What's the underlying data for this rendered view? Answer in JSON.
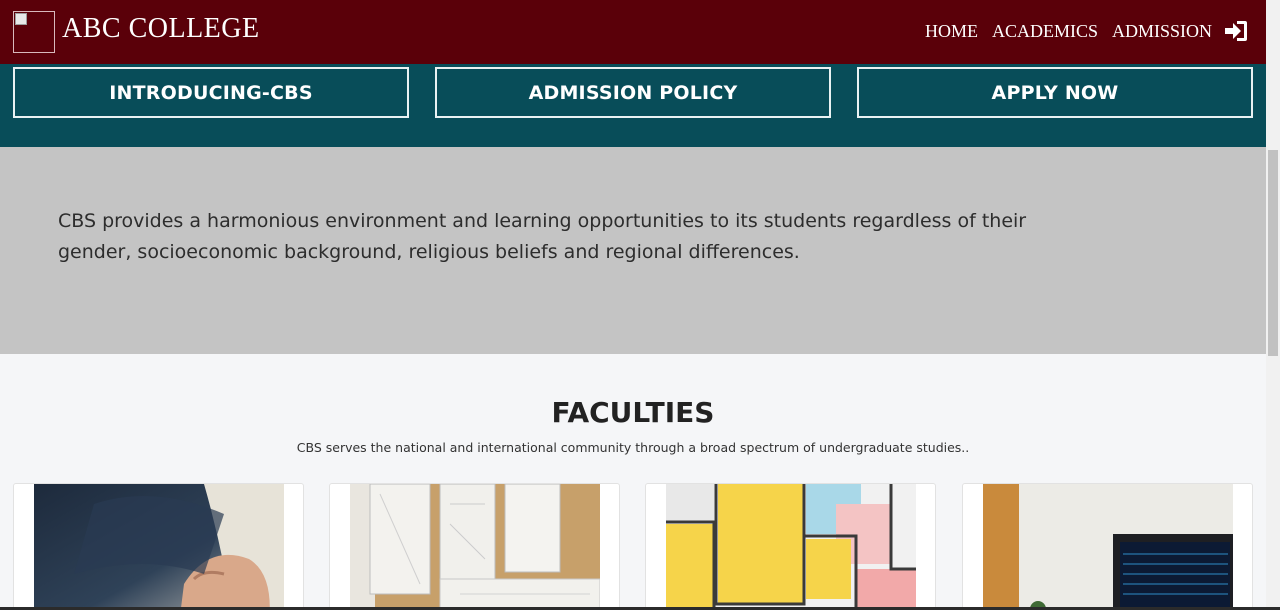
{
  "navbar": {
    "brand": "ABC COLLEGE",
    "links": [
      "HOME",
      "ACADEMICS",
      "ADMISSION"
    ],
    "login_icon": "sign-in-icon",
    "bg_color": "#5a0009"
  },
  "band": {
    "buttons": [
      "INTRODUCING-CBS",
      "ADMISSION POLICY",
      "APPLY NOW"
    ],
    "bg_color": "#084d59"
  },
  "intro": {
    "text": "CBS provides a harmonious environment and learning opportunities to its students regardless of their gender, socioeconomic background, religious beliefs and regional differences."
  },
  "faculties": {
    "title": "FACULTIES",
    "subtitle": "CBS serves the national and international community through a broad spectrum of undergraduate studies..",
    "cards": [
      {
        "image": "business-hand-photo"
      },
      {
        "image": "architecture-blueprints-photo"
      },
      {
        "image": "floor-plan-photo"
      },
      {
        "image": "laptop-trading-photo"
      }
    ]
  }
}
